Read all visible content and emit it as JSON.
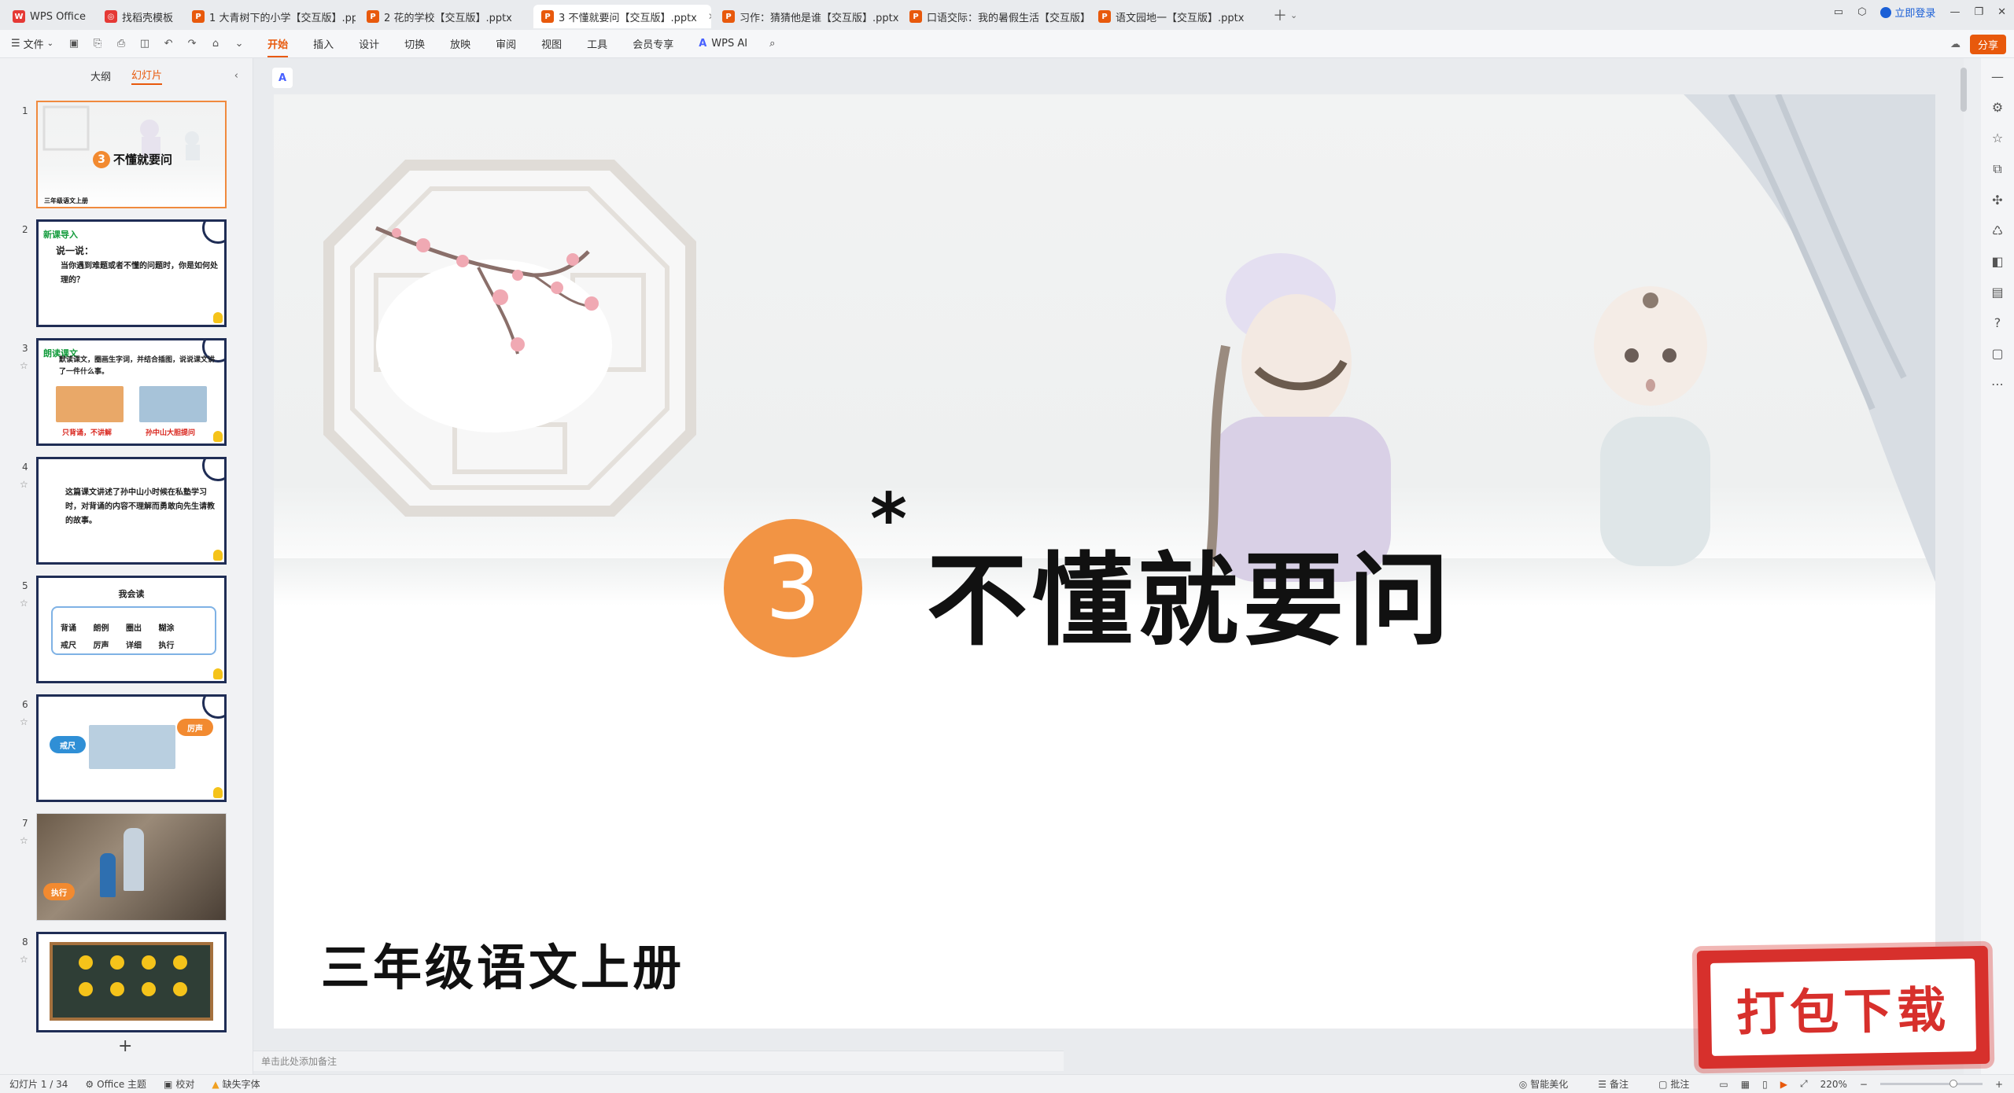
{
  "tabs": [
    {
      "label": "WPS Office",
      "icon": "wps-logo-icon",
      "active": false
    },
    {
      "label": "找稻壳模板",
      "icon": "docer-icon",
      "active": false
    },
    {
      "label": "1 大青树下的小学【交互版】.pptx",
      "icon": "ppt-file-icon",
      "active": false
    },
    {
      "label": "2 花的学校【交互版】.pptx",
      "icon": "ppt-file-icon",
      "active": false
    },
    {
      "label": "3 不懂就要问【交互版】.pptx",
      "icon": "ppt-file-icon",
      "active": true
    },
    {
      "label": "习作：猜猜他是谁【交互版】.pptx",
      "icon": "ppt-file-icon",
      "active": false
    },
    {
      "label": "口语交际：我的暑假生活【交互版】.",
      "icon": "ppt-file-icon",
      "active": false
    },
    {
      "label": "语文园地一【交互版】.pptx",
      "icon": "ppt-file-icon",
      "active": false
    }
  ],
  "top_right": {
    "login": "立即登录"
  },
  "menubar": {
    "file": "文件",
    "items": [
      "开始",
      "插入",
      "设计",
      "切换",
      "放映",
      "审阅",
      "视图",
      "工具",
      "会员专享"
    ],
    "active": "开始",
    "ai": "WPS AI",
    "share": "分享"
  },
  "left_panel": {
    "tab_outline": "大纲",
    "tab_slides": "幻灯片",
    "thumbs": [
      {
        "num": "1",
        "title": "不懂就要问",
        "circle": "3",
        "sub": "三年级语文上册"
      },
      {
        "num": "2",
        "tag": "新课导入",
        "head": "说一说：",
        "body": "当你遇到难题或者不懂的问题时，你是如何处理的？"
      },
      {
        "num": "3",
        "tag": "朗读课文",
        "body": "默读课文，圈画生字词，并结合插图，说说课文讲了一件什么事。",
        "cap1": "只背诵，不讲解",
        "cap2": "孙中山大胆提问"
      },
      {
        "num": "4",
        "body": "这篇课文讲述了孙中山小时候在私塾学习时，对背诵的内容不理解而勇敢向先生请教的故事。"
      },
      {
        "num": "5",
        "title": "我会读",
        "words": [
          "背诵",
          "朗例",
          "圈出",
          "糊涂",
          "戒尺",
          "厉声",
          "详细",
          "执行"
        ]
      },
      {
        "num": "6",
        "b1": "戒尺",
        "b2": "厉声"
      },
      {
        "num": "7",
        "b1": "执行"
      },
      {
        "num": "8"
      }
    ],
    "add": "+"
  },
  "slide": {
    "number": "3",
    "star": "*",
    "title": "不懂就要问",
    "subtitle": "三年级语文上册"
  },
  "notes_placeholder": "单击此处添加备注",
  "stamp": "打包下载",
  "statusbar": {
    "slide_info": "幻灯片 1 / 34",
    "theme": "Office 主题",
    "proof": "校对",
    "missing_font": "缺失字体",
    "beautify": "智能美化",
    "notes": "备注",
    "comment": "批注",
    "zoom": "220%"
  }
}
